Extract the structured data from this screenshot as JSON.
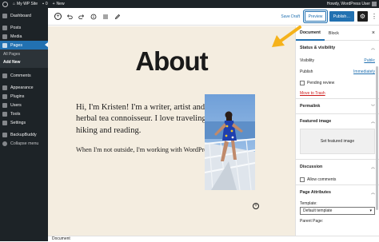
{
  "adminbar": {
    "site_name": "My WP Site",
    "comments_count": "0",
    "new_label": "New",
    "howdy": "Howdy, WordPress User"
  },
  "menu": {
    "items": [
      {
        "label": "Dashboard",
        "icon": "dashboard-icon"
      },
      {
        "label": "Posts",
        "icon": "pin-icon"
      },
      {
        "label": "Media",
        "icon": "media-icon"
      },
      {
        "label": "Pages",
        "icon": "page-icon"
      },
      {
        "label": "Comments",
        "icon": "comment-icon"
      },
      {
        "label": "Appearance",
        "icon": "brush-icon"
      },
      {
        "label": "Plugins",
        "icon": "plug-icon"
      },
      {
        "label": "Users",
        "icon": "user-icon"
      },
      {
        "label": "Tools",
        "icon": "wrench-icon"
      },
      {
        "label": "Settings",
        "icon": "settings-icon"
      },
      {
        "label": "BackupBuddy",
        "icon": "backup-icon"
      },
      {
        "label": "Collapse menu",
        "icon": "collapse-icon"
      }
    ],
    "submenu": [
      "All Pages",
      "Add New"
    ]
  },
  "toolbar": {
    "save_draft": "Save Draft",
    "preview": "Preview",
    "publish": "Publish…"
  },
  "content": {
    "title": "About",
    "para1": "Hi, I'm Kristen! I'm a writer, artist and herbal tea connoisseur. I love traveling, hiking and reading.",
    "para2": "When I'm not outside, I'm working with WordPress."
  },
  "sidebar": {
    "tab_document": "Document",
    "tab_block": "Block",
    "status_title": "Status & visibility",
    "visibility_label": "Visibility",
    "visibility_value": "Public",
    "publish_label": "Publish",
    "publish_value": "Immediately",
    "pending_review": "Pending review",
    "move_to_trash": "Move to Trash",
    "permalink": "Permalink",
    "featured_image": "Featured image",
    "set_featured_image": "Set featured image",
    "discussion": "Discussion",
    "allow_comments": "Allow comments",
    "page_attributes": "Page Attributes",
    "template_label": "Template:",
    "template_value": "Default template",
    "parent_page": "Parent Page:"
  },
  "footer": {
    "breadcrumb": "Document"
  },
  "colors": {
    "accent": "#2271b1",
    "admin_dark": "#1d2327",
    "canvas_bg": "#f4ede0",
    "annotation_arrow": "#f5b21b"
  }
}
